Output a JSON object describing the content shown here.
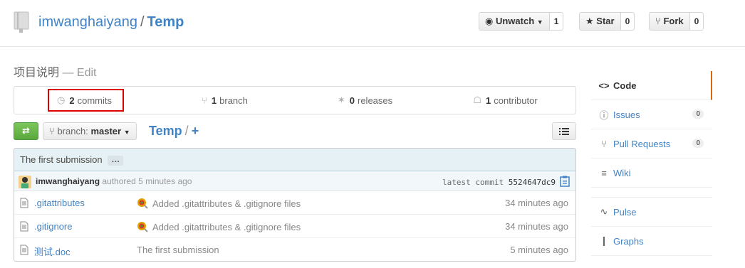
{
  "repo": {
    "owner": "imwanghaiyang",
    "separator": "/",
    "name": "Temp",
    "description": "项目说明",
    "edit_label": "— Edit"
  },
  "actions": {
    "watch_label": "Unwatch",
    "watch_count": "1",
    "star_label": "Star",
    "star_count": "0",
    "fork_label": "Fork",
    "fork_count": "0"
  },
  "summary": {
    "commits_num": "2",
    "commits_label": "commits",
    "branch_num": "1",
    "branch_label": "branch",
    "releases_num": "0",
    "releases_label": "releases",
    "contributor_num": "1",
    "contributor_label": "contributor"
  },
  "filenav": {
    "branch_prefix": "branch:",
    "branch_name": "master",
    "breadcrumb_root": "Temp",
    "breadcrumb_sep": "/",
    "breadcrumb_add": "+"
  },
  "commit": {
    "title": "The first submission",
    "ellipsis": "…",
    "author": "imwanghaiyang",
    "authored_text": "authored 5 minutes ago",
    "latest_label": "latest commit",
    "sha": "5524647dc9"
  },
  "files": [
    {
      "name": ".gitattributes",
      "message": "Added .gitattributes & .gitignore files",
      "age": "34 minutes ago"
    },
    {
      "name": ".gitignore",
      "message": "Added .gitattributes & .gitignore files",
      "age": "34 minutes ago"
    },
    {
      "name": "测试.doc",
      "message": "The first submission",
      "age": "5 minutes ago"
    }
  ],
  "sidebar": {
    "code": "Code",
    "issues": "Issues",
    "issues_count": "0",
    "pulls": "Pull Requests",
    "pulls_count": "0",
    "wiki": "Wiki",
    "pulse": "Pulse",
    "graphs": "Graphs"
  },
  "colors": {
    "link": "#4183c4",
    "accent_selected": "#d26911",
    "compare_green": "#6cc644",
    "highlight_box": "#dd0000"
  }
}
